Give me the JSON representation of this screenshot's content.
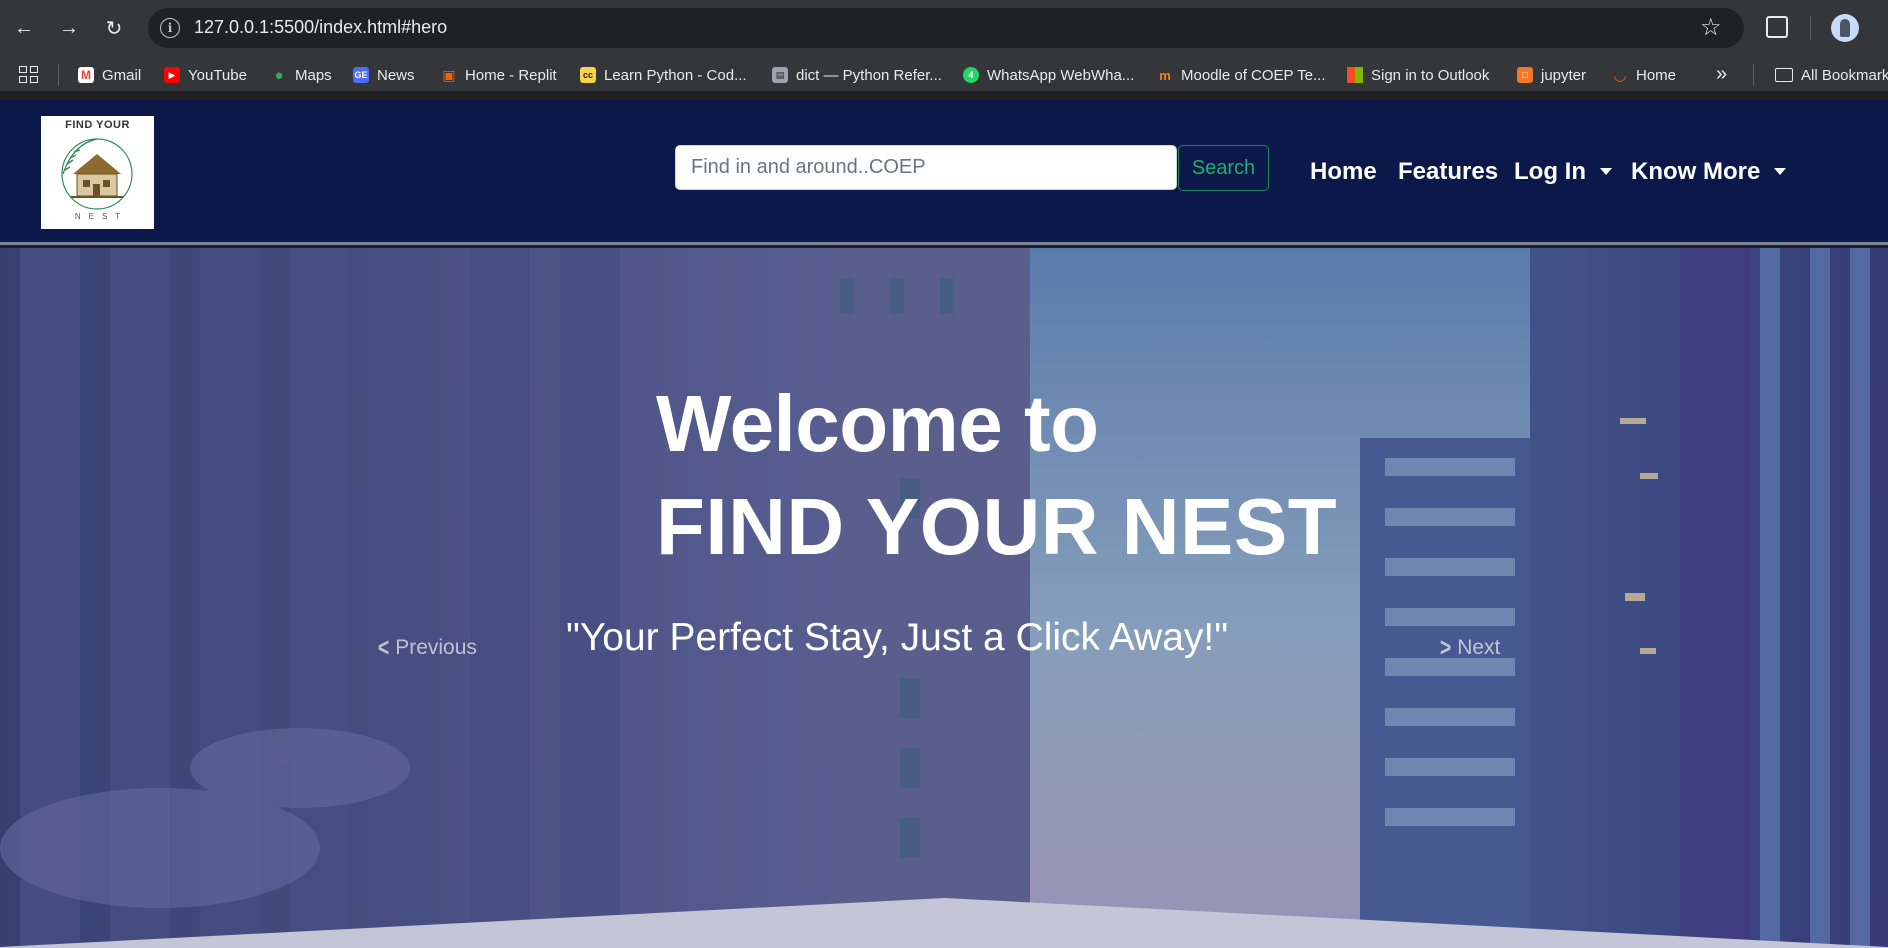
{
  "browser": {
    "url": "127.0.0.1:5500/index.html#hero",
    "bookmarks": [
      {
        "label": "Gmail",
        "icon": "gmail-icon",
        "color": "#ea4335"
      },
      {
        "label": "YouTube",
        "icon": "youtube-icon",
        "color": "#ff0000"
      },
      {
        "label": "Maps",
        "icon": "maps-icon",
        "color": "#34a853"
      },
      {
        "label": "News",
        "icon": "news-icon",
        "color": "#4c6ef5"
      },
      {
        "label": "Home - Replit",
        "icon": "replit-icon",
        "color": "#f26207"
      },
      {
        "label": "Learn Python - Cod...",
        "icon": "codecademy-icon",
        "color": "#1f1f1f"
      },
      {
        "label": "dict — Python Refer...",
        "icon": "python-reference-icon",
        "color": "#6b7280"
      },
      {
        "label": "WhatsApp WebWha...",
        "icon": "whatsapp-icon",
        "color": "#25d366"
      },
      {
        "label": "Moodle of COEP Te...",
        "icon": "moodle-icon",
        "color": "#f98012"
      },
      {
        "label": "Sign in to Outlook",
        "icon": "microsoft-icon",
        "color": "#0078d4"
      },
      {
        "label": "jupyter",
        "icon": "jupyter-icon",
        "color": "#f37726"
      },
      {
        "label": "Home",
        "icon": "home-loader-icon",
        "color": "#ea580c"
      }
    ],
    "all_bookmarks": "All Bookmarks"
  },
  "site": {
    "logo": {
      "title": "FIND YOUR",
      "subtitle": "NEST"
    },
    "search": {
      "placeholder": "Find in and around..COEP",
      "button": "Search"
    },
    "nav": {
      "home": "Home",
      "features": "Features",
      "login": "Log In",
      "know_more": "Know More"
    }
  },
  "hero": {
    "welcome": "Welcome to",
    "brand": "FIND YOUR NEST",
    "tagline": "\"Your Perfect Stay, Just a Click Away!\"",
    "previous": "Previous",
    "next": "Next"
  }
}
